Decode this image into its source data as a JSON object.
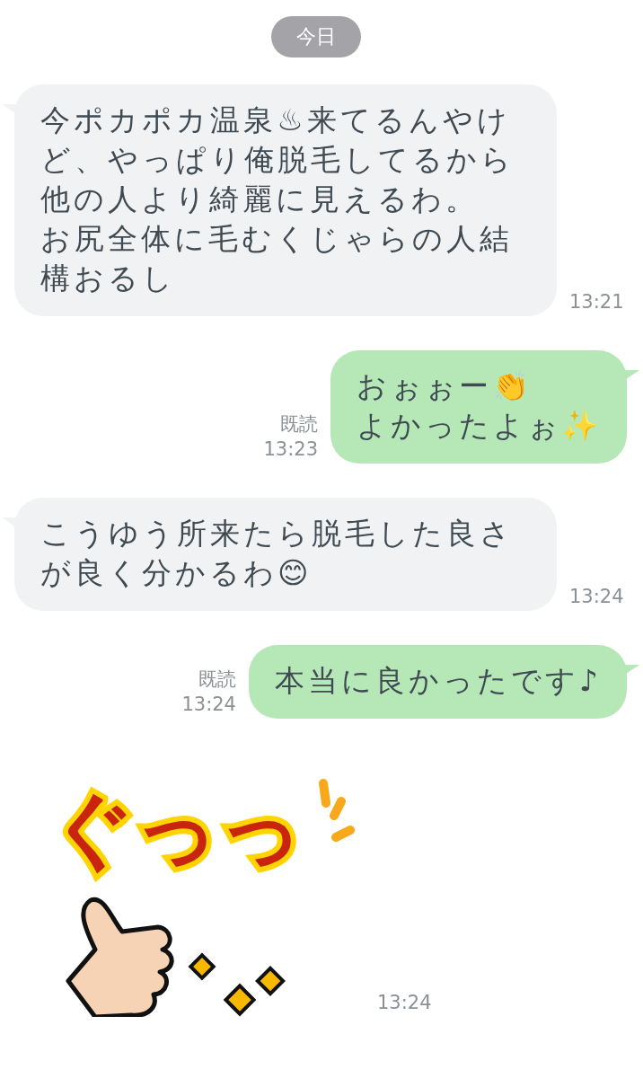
{
  "date_badge": "今日",
  "messages": [
    {
      "kind": "incoming",
      "lines": [
        "今ポカポカ温泉♨来てるんやけど、やっぱり俺脱毛してるから他の人より綺麗に見えるわ。",
        "お尻全体に毛むくじゃらの人結構おるし"
      ],
      "time": "13:21"
    },
    {
      "kind": "outgoing",
      "lines": [
        "おぉぉー👏",
        "よかったよぉ✨"
      ],
      "read_label": "既読",
      "time": "13:23"
    },
    {
      "kind": "incoming",
      "lines": [
        "こうゆう所来たら脱毛した良さが良く分かるわ😊"
      ],
      "time": "13:24"
    },
    {
      "kind": "outgoing",
      "lines": [
        "本当に良かったです♪"
      ],
      "read_label": "既読",
      "time": "13:24"
    },
    {
      "kind": "sticker",
      "text": "ぐっっ",
      "time": "13:24"
    }
  ]
}
